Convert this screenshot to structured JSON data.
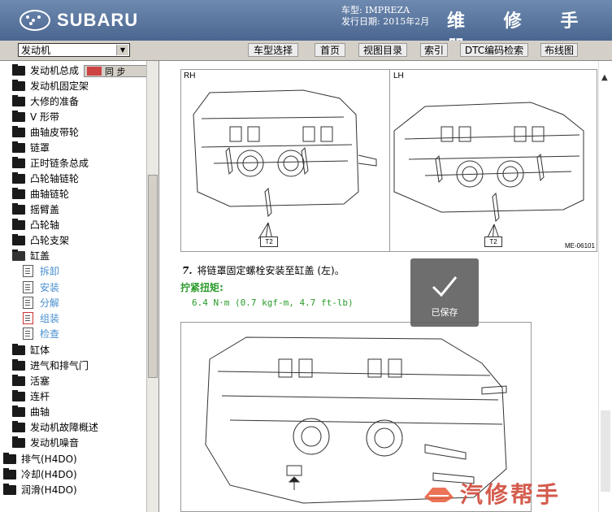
{
  "header": {
    "brand": "SUBARU",
    "car_model": "车型: IMPREZA",
    "issue_date": "发行日期: 2015年2月",
    "manual_title": "维 修 手 册"
  },
  "toolbar": {
    "section_select": "发动机",
    "buttons": [
      "车型选择",
      "首页",
      "视图目录",
      "索引",
      "DTC编码检索",
      "布线图"
    ]
  },
  "sidebar": {
    "nav_tab_label": "同  步",
    "items": [
      {
        "label": "发动机总成",
        "type": "folder"
      },
      {
        "label": "发动机固定架",
        "type": "folder"
      },
      {
        "label": "大修的准备",
        "type": "folder"
      },
      {
        "label": "V 形带",
        "type": "folder"
      },
      {
        "label": "曲轴皮带轮",
        "type": "folder"
      },
      {
        "label": "链罩",
        "type": "folder"
      },
      {
        "label": "正时链条总成",
        "type": "folder"
      },
      {
        "label": "凸轮轴链轮",
        "type": "folder"
      },
      {
        "label": "曲轴链轮",
        "type": "folder"
      },
      {
        "label": "摇臂盖",
        "type": "folder"
      },
      {
        "label": "凸轮轴",
        "type": "folder"
      },
      {
        "label": "凸轮支架",
        "type": "folder"
      },
      {
        "label": "缸盖",
        "type": "folder-open"
      },
      {
        "label": "拆卸",
        "type": "doc"
      },
      {
        "label": "安装",
        "type": "doc"
      },
      {
        "label": "分解",
        "type": "doc"
      },
      {
        "label": "组装",
        "type": "doc-active"
      },
      {
        "label": "检查",
        "type": "doc"
      },
      {
        "label": "缸体",
        "type": "folder"
      },
      {
        "label": "进气和排气门",
        "type": "folder"
      },
      {
        "label": "活塞",
        "type": "folder"
      },
      {
        "label": "连杆",
        "type": "folder"
      },
      {
        "label": "曲轴",
        "type": "folder"
      },
      {
        "label": "发动机故障概述",
        "type": "folder"
      },
      {
        "label": "发动机噪音",
        "type": "folder"
      },
      {
        "label": "排气(H4DO)",
        "type": "folder-root"
      },
      {
        "label": "冷却(H4DO)",
        "type": "folder-root"
      },
      {
        "label": "润滑(H4DO)",
        "type": "folder-root"
      }
    ]
  },
  "content": {
    "figure1": {
      "left_label": "RH",
      "right_label": "LH",
      "callout": "T2",
      "code": "ME-06101"
    },
    "step_number": "7.",
    "step_text": "将链罩固定螺栓安装至缸盖 (左)。",
    "torque_title": "拧紧扭矩:",
    "torque_value": "6.4 N·m (0.7 kgf-m, 4.7 ft-lb)"
  },
  "toast": {
    "label": "已保存"
  },
  "watermark": {
    "text": "汽修帮手"
  }
}
